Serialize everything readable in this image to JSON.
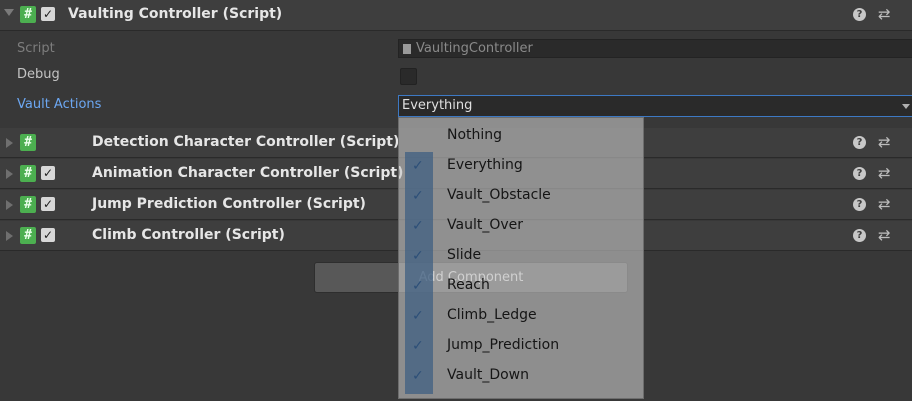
{
  "main_component": {
    "title": "Vaulting Controller (Script)",
    "fields": {
      "script_label": "Script",
      "script_value": "VaultingController",
      "debug_label": "Debug",
      "vault_actions_label": "Vault Actions",
      "vault_actions_value": "Everything"
    }
  },
  "components": [
    {
      "title": "Detection Character Controller (Script)",
      "enabled_checkbox": false
    },
    {
      "title": "Animation Character Controller (Script)",
      "enabled_checkbox": true
    },
    {
      "title": "Jump Prediction Controller (Script)",
      "enabled_checkbox": true
    },
    {
      "title": "Climb Controller (Script)",
      "enabled_checkbox": true
    }
  ],
  "add_component_label": "Add Component",
  "dropdown_items": [
    {
      "label": "Nothing",
      "checked": false
    },
    {
      "label": "Everything",
      "checked": true
    },
    {
      "label": "Vault_Obstacle",
      "checked": true
    },
    {
      "label": "Vault_Over",
      "checked": true
    },
    {
      "label": "Slide",
      "checked": true
    },
    {
      "label": "Reach",
      "checked": true
    },
    {
      "label": "Climb_Ledge",
      "checked": true
    },
    {
      "label": "Jump_Prediction",
      "checked": true
    },
    {
      "label": "Vault_Down",
      "checked": true
    }
  ],
  "glyphs": {
    "check": "✓",
    "hash": "#",
    "help": "?",
    "preset": "⇄"
  },
  "colors": {
    "script_icon": "#4caf50",
    "highlight_label": "#6ca7f2",
    "dropdown_selection": "#3f5f82"
  }
}
